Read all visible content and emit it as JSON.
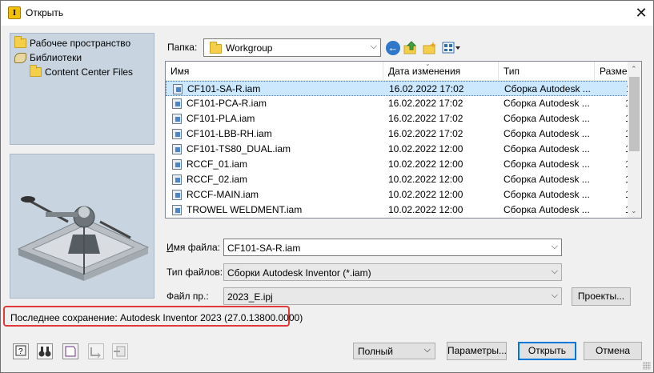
{
  "window": {
    "title": "Открыть",
    "close_glyph": "✕"
  },
  "places": [
    {
      "label": "Рабочее пространство",
      "icon": "folder-icon"
    },
    {
      "label": "Библиотеки",
      "icon": "libraries-icon"
    },
    {
      "label": "Content Center Files",
      "icon": "folder-icon"
    }
  ],
  "folder": {
    "label": "Папка:",
    "value": "Workgroup"
  },
  "columns": [
    "Имя",
    "Дата изменения",
    "Тип",
    "Размер"
  ],
  "files": [
    {
      "name": "CF101-SA-R.iam",
      "date": "16.02.2022 17:02",
      "type": "Сборка Autodesk ...",
      "size": "1",
      "selected": true
    },
    {
      "name": "CF101-PCA-R.iam",
      "date": "16.02.2022 17:02",
      "type": "Сборка Autodesk ...",
      "size": "1"
    },
    {
      "name": "CF101-PLA.iam",
      "date": "16.02.2022 17:02",
      "type": "Сборка Autodesk ...",
      "size": "1"
    },
    {
      "name": "CF101-LBB-RH.iam",
      "date": "16.02.2022 17:02",
      "type": "Сборка Autodesk ...",
      "size": "1"
    },
    {
      "name": "CF101-TS80_DUAL.iam",
      "date": "10.02.2022 12:00",
      "type": "Сборка Autodesk ...",
      "size": "1"
    },
    {
      "name": "RCCF_01.iam",
      "date": "10.02.2022 12:00",
      "type": "Сборка Autodesk ...",
      "size": "1"
    },
    {
      "name": "RCCF_02.iam",
      "date": "10.02.2022 12:00",
      "type": "Сборка Autodesk ...",
      "size": "1"
    },
    {
      "name": "RCCF-MAIN.iam",
      "date": "10.02.2022 12:00",
      "type": "Сборка Autodesk ...",
      "size": "1"
    },
    {
      "name": "TROWEL WELDMENT.iam",
      "date": "10.02.2022 12:00",
      "type": "Сборка Autodesk ...",
      "size": "1"
    }
  ],
  "filename": {
    "label": "Имя файла:",
    "value": "CF101-SA-R.iam"
  },
  "filetype": {
    "label": "Тип файлов:",
    "value": "Сборки Autodesk Inventor (*.iam)"
  },
  "project": {
    "label": "Файл пр.:",
    "value": "2023_E.ipj",
    "button": "Проекты..."
  },
  "status": "Последнее сохранение: Autodesk Inventor 2023 (27.0.13800.0000)",
  "footer": {
    "mode": "Полный",
    "params": "Параметры...",
    "open": "Открыть",
    "cancel": "Отмена"
  },
  "colors": {
    "accent": "#0078d7",
    "highlight": "#e03a3a",
    "selection": "#cce8ff",
    "panel": "#c8d5e1"
  }
}
